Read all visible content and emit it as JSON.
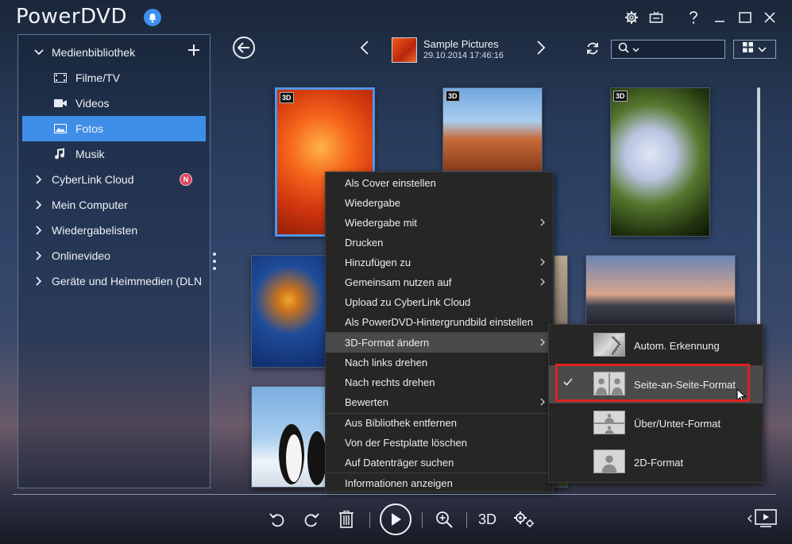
{
  "app": {
    "title": "PowerDVD"
  },
  "header": {
    "album_title": "Sample Pictures",
    "album_date": "29.10.2014 17:46:16"
  },
  "sidebar": {
    "items": [
      {
        "label": "Medienbibliothek",
        "expanded": true
      },
      {
        "label": "Filme/TV",
        "icon": "film-icon"
      },
      {
        "label": "Videos",
        "icon": "video-camera-icon"
      },
      {
        "label": "Fotos",
        "icon": "photo-icon",
        "selected": true
      },
      {
        "label": "Musik",
        "icon": "music-note-icon"
      },
      {
        "label": "CyberLink Cloud",
        "badge": "N"
      },
      {
        "label": "Mein Computer"
      },
      {
        "label": "Wiedergabelisten"
      },
      {
        "label": "Onlinevideo"
      },
      {
        "label": "Geräte und Heimmedien (DLN"
      }
    ]
  },
  "photos": {
    "badge_3d": "3D"
  },
  "context_menu": {
    "items": [
      {
        "label": "Als Cover einstellen"
      },
      {
        "label": "Wiedergabe"
      },
      {
        "label": "Wiedergabe mit",
        "submenu": true
      },
      {
        "label": "Drucken"
      },
      {
        "label": "Hinzufügen zu",
        "submenu": true
      },
      {
        "label": "Gemeinsam nutzen auf",
        "submenu": true
      },
      {
        "label": "Upload zu CyberLink Cloud"
      },
      {
        "label": "Als PowerDVD-Hintergrundbild einstellen"
      },
      {
        "label": "3D-Format ändern",
        "submenu": true,
        "highlighted": true
      },
      {
        "label": "Nach links drehen"
      },
      {
        "label": "Nach rechts drehen"
      },
      {
        "label": "Bewerten",
        "submenu": true
      },
      {
        "label": "Aus Bibliothek entfernen"
      },
      {
        "label": "Von der Festplatte löschen"
      },
      {
        "label": "Auf Datenträger suchen"
      },
      {
        "label": "Informationen anzeigen"
      }
    ]
  },
  "submenu_3d": {
    "items": [
      {
        "label": "Autom. Erkennung",
        "icon": "auto-detect-icon"
      },
      {
        "label": "Seite-an-Seite-Format",
        "icon": "side-by-side-icon",
        "checked": true,
        "highlighted": true
      },
      {
        "label": "Über/Unter-Format",
        "icon": "over-under-icon"
      },
      {
        "label": "2D-Format",
        "icon": "2d-format-icon"
      }
    ]
  },
  "toolbar": {
    "label_3d": "3D"
  },
  "colors": {
    "accent": "#3e8ee8",
    "menu_bg": "#262626",
    "menu_highlight": "#4a4a4a",
    "callout_red": "#e02020"
  }
}
